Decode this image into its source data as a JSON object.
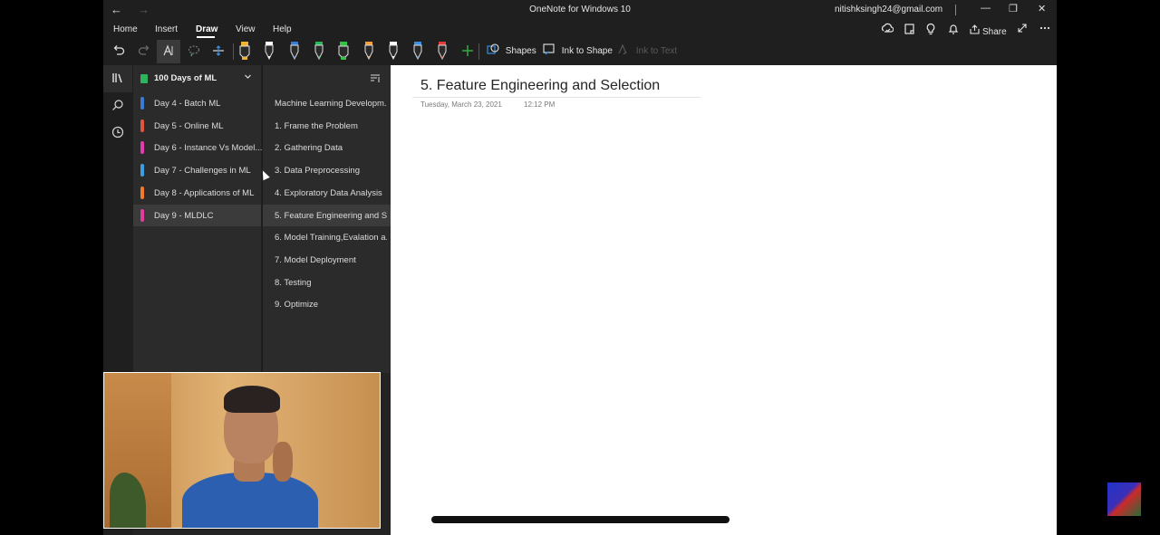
{
  "window": {
    "title": "OneNote for Windows 10",
    "account": "nitishksingh24@gmail.com",
    "back_glyph": "←",
    "forward_glyph": "→",
    "minimize_glyph": "—",
    "restore_glyph": "❐",
    "close_glyph": "✕"
  },
  "menu": {
    "tabs": [
      {
        "label": "Home"
      },
      {
        "label": "Insert"
      },
      {
        "label": "Draw",
        "active": true
      },
      {
        "label": "View"
      },
      {
        "label": "Help"
      }
    ],
    "share_label": "Share",
    "icons": [
      "sync-icon",
      "notebook-icon",
      "lightbulb-icon",
      "bell-icon",
      "share-icon",
      "fullscreen-icon",
      "more-icon"
    ]
  },
  "toolbar": {
    "shapes_label": "Shapes",
    "ink_to_shape_label": "Ink to Shape",
    "ink_to_text_label": "Ink to Text",
    "pens": [
      {
        "color": "#f0b432",
        "kind": "highlighter-icon"
      },
      {
        "color": "#ffffff",
        "kind": "pen-icon"
      },
      {
        "color": "#3a7bd5",
        "kind": "pen-icon"
      },
      {
        "color": "#2db55d",
        "kind": "pen-icon"
      },
      {
        "color": "#35c247",
        "kind": "highlighter-icon"
      },
      {
        "color": "#f2a03a",
        "kind": "pen-icon"
      },
      {
        "color": "#ffffff",
        "kind": "pen-icon"
      },
      {
        "color": "#3a8fe0",
        "kind": "pen-icon"
      },
      {
        "color": "#e23b3b",
        "kind": "pen-icon"
      }
    ]
  },
  "notebook": {
    "name": "100 Days of ML",
    "color": "#2db55d"
  },
  "sections": [
    {
      "label": "Day 4 - Batch ML",
      "color": "#3a7bd5"
    },
    {
      "label": "Day 5 - Online ML",
      "color": "#e0563b"
    },
    {
      "label": "Day 6 - Instance Vs Model...",
      "color": "#e23bb0"
    },
    {
      "label": "Day 7 - Challenges in ML",
      "color": "#3a9fe0"
    },
    {
      "label": "Day 8 - Applications of ML",
      "color": "#f07a2a"
    },
    {
      "label": "Day 9 - MLDLC",
      "color": "#e23b9f",
      "selected": true
    }
  ],
  "pages": [
    {
      "label": "Machine Learning Developm..."
    },
    {
      "label": "1. Frame the Problem"
    },
    {
      "label": "2. Gathering Data"
    },
    {
      "label": "3. Data Preprocessing"
    },
    {
      "label": "4. Exploratory Data Analysis"
    },
    {
      "label": "5. Feature Engineering and S...",
      "selected": true
    },
    {
      "label": "6. Model Training,Evalation a..."
    },
    {
      "label": "7. Model Deployment"
    },
    {
      "label": "8. Testing"
    },
    {
      "label": "9. Optimize"
    }
  ],
  "page": {
    "title": "5. Feature Engineering and Selection",
    "date": "Tuesday, March 23, 2021",
    "time": "12:12 PM"
  }
}
